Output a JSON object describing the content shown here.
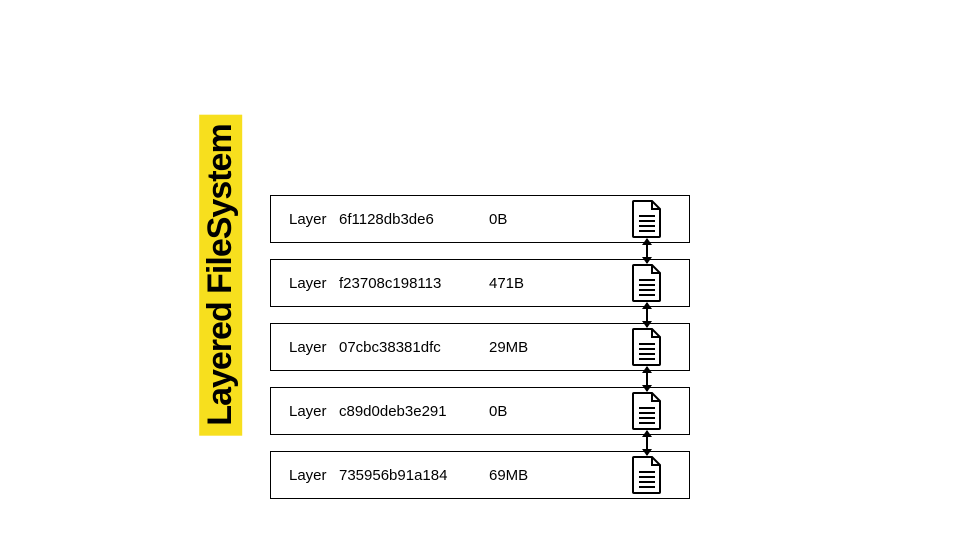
{
  "title": "Layered FileSystem",
  "layer_word": "Layer",
  "layers": [
    {
      "hash": "6f1128db3de6",
      "size": "0B"
    },
    {
      "hash": "f23708c198113",
      "size": "471B"
    },
    {
      "hash": "07cbc38381dfc",
      "size": "29MB"
    },
    {
      "hash": "c89d0deb3e291",
      "size": "0B"
    },
    {
      "hash": "735956b91a184",
      "size": "69MB"
    }
  ]
}
